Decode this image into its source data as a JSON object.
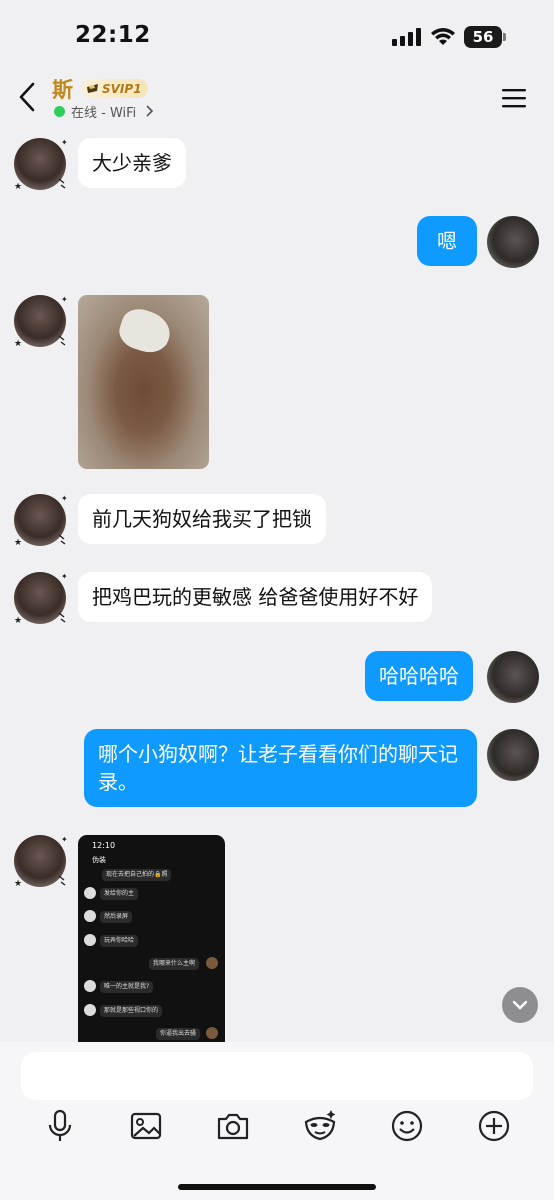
{
  "status_bar": {
    "time": "22:12",
    "battery": "56"
  },
  "header": {
    "contact_name": "斯",
    "badge": "SVIP1",
    "online_status": "在线 - WiFi"
  },
  "messages": [
    {
      "side": "in",
      "type": "text",
      "text": "大少亲爹"
    },
    {
      "side": "out",
      "type": "text",
      "text": "嗯"
    },
    {
      "side": "in",
      "type": "image"
    },
    {
      "side": "in",
      "type": "text",
      "text": "前几天狗奴给我买了把锁"
    },
    {
      "side": "in",
      "type": "text",
      "text": "把鸡巴玩的更敏感 给爸爸使用好不好"
    },
    {
      "side": "out",
      "type": "text",
      "text": "哈哈哈哈"
    },
    {
      "side": "out",
      "type": "text",
      "text": "哪个小狗奴啊？让老子看看你们的聊天记录。"
    },
    {
      "side": "in",
      "type": "image"
    }
  ],
  "embedded_screenshot": {
    "time": "12:10",
    "title": "伪装",
    "rows": [
      {
        "side": "in",
        "text": "现在去把自己拍的🔒照"
      },
      {
        "side": "in",
        "text": "发给你的主"
      },
      {
        "side": "in",
        "text": "然后录屏"
      },
      {
        "side": "in",
        "text": "玩弄你哈哈"
      },
      {
        "side": "out",
        "text": "我哪来什么主啊"
      },
      {
        "side": "in",
        "text": "唯一的主就是我?"
      },
      {
        "side": "in",
        "text": "那就是那些视口你的"
      },
      {
        "side": "out",
        "text": "你逼我出去骚"
      }
    ]
  },
  "input": {
    "placeholder": ""
  },
  "toolbar": [
    "mic-icon",
    "image-icon",
    "camera-icon",
    "mask-icon",
    "emoji-icon",
    "plus-icon"
  ],
  "colors": {
    "bubble_out": "#0e9aff",
    "bubble_in": "#ffffff",
    "online": "#2fd05a",
    "svip_gold": "#c08a1e"
  }
}
